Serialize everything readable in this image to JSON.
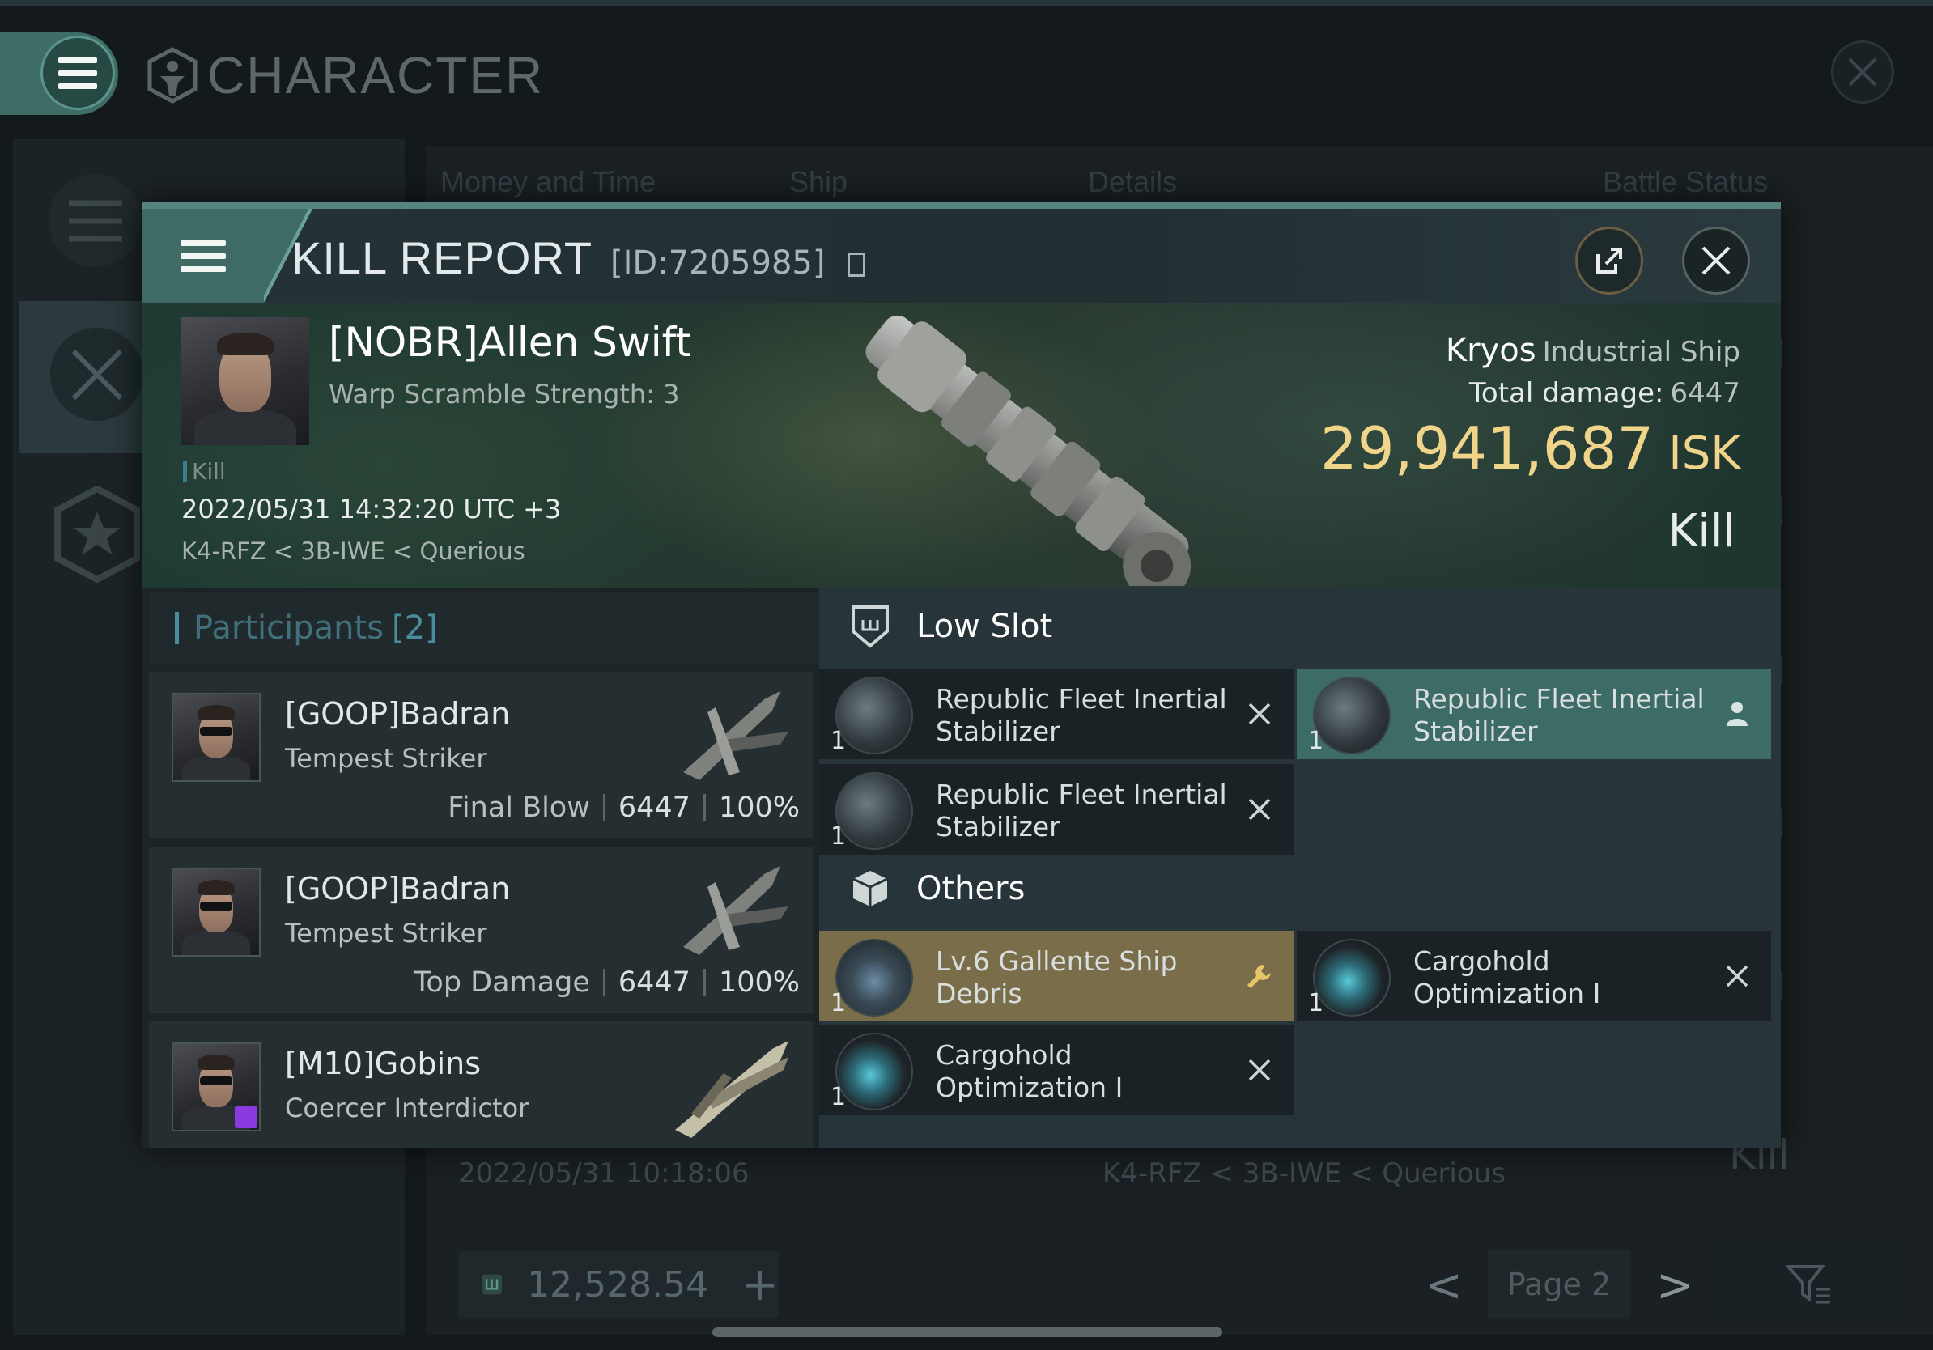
{
  "background": {
    "title": "CHARACTER",
    "columns": [
      "Money and Time",
      "Ship",
      "Details",
      "Battle Status"
    ],
    "row": {
      "date": "2022/05/31 10:18:06",
      "location": "K4-RFZ < 3B-IWE < Querious",
      "status": "Kill"
    },
    "wallet": "12,528.54",
    "page": "Page 2"
  },
  "modal": {
    "title": "KILL REPORT",
    "id_label": "[ID:7205985]"
  },
  "victim": {
    "name": "[NOBR]Allen Swift",
    "subtitle": "Warp Scramble Strength: 3",
    "tag": "Kill",
    "datetime": "2022/05/31 14:32:20 UTC +3",
    "location": "K4-RFZ < 3B-IWE < Querious",
    "ship_name": "Kryos",
    "ship_class": "Industrial Ship",
    "total_damage_label": "Total damage:",
    "total_damage": "6447",
    "isk_value": "29,941,687",
    "isk_unit": "ISK",
    "status": "Kill"
  },
  "participants": {
    "title": "Participants",
    "count": "[2]",
    "rows": [
      {
        "name": "[GOOP]Badran",
        "ship": "Tempest Striker",
        "label": "Final Blow",
        "damage": "6447",
        "percent": "100%"
      },
      {
        "name": "[GOOP]Badran",
        "ship": "Tempest Striker",
        "label": "Top Damage",
        "damage": "6447",
        "percent": "100%"
      },
      {
        "name": "[M10]Gobins",
        "ship": "Coercer Interdictor"
      }
    ]
  },
  "fitting": {
    "low_slot_title": "Low Slot",
    "others_title": "Others",
    "low_slot_items": [
      {
        "qty": "1",
        "name": "Republic Fleet Inertial Stabilizer",
        "state": "destroyed"
      },
      {
        "qty": "1",
        "name": "Republic Fleet Inertial Stabilizer",
        "state": "fitted"
      },
      {
        "qty": "1",
        "name": "Republic Fleet Inertial Stabilizer",
        "state": "destroyed"
      }
    ],
    "other_items": [
      {
        "qty": "1",
        "name": "Lv.6 Gallente Ship Debris",
        "state": "dropped"
      },
      {
        "qty": "1",
        "name": "Cargohold Optimization I",
        "state": "destroyed"
      },
      {
        "qty": "1",
        "name": "Cargohold Optimization I",
        "state": "destroyed"
      }
    ]
  },
  "colors": {
    "accent": "#3e6b63",
    "isk": "#f0d48a",
    "participants": "#4c8c9a",
    "dropped": "#7a6e4a"
  }
}
